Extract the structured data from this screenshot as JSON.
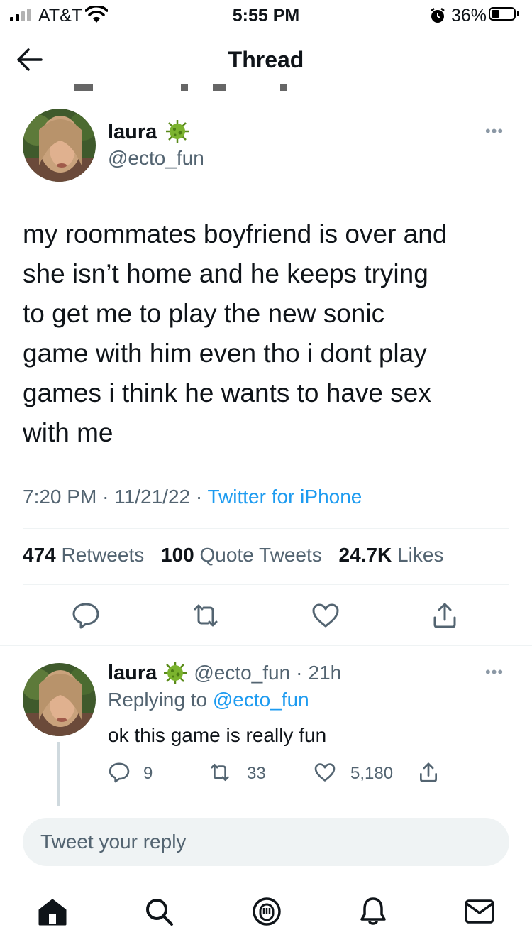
{
  "status_bar": {
    "carrier": "AT&T",
    "time": "5:55 PM",
    "battery_percent": "36%",
    "signal_icon": "signal-bars-icon",
    "wifi_icon": "wifi-icon",
    "alarm_icon": "alarm-clock-icon"
  },
  "header": {
    "title": "Thread",
    "back_icon": "arrow-left-icon"
  },
  "main_tweet": {
    "name": "laura",
    "badge_icon": "virus-emoji-icon",
    "handle": "@ecto_fun",
    "text": "my roommates boyfriend is over and\nshe isn’t home and he keeps trying\nto get me to play the new sonic\ngame with him even tho i dont play\ngames i think he wants to have sex\nwith me",
    "time": "7:20 PM",
    "date": "11/21/22",
    "source": "Twitter for iPhone",
    "retweets_count": "474",
    "retweets_label": "Retweets",
    "quotes_count": "100",
    "quotes_label": "Quote Tweets",
    "likes_count": "24.7K",
    "likes_label": "Likes"
  },
  "reply": {
    "name": "laura",
    "handle": "@ecto_fun",
    "age": "21h",
    "replying_prefix": "Replying to",
    "replying_handle": "@ecto_fun",
    "text": "ok this game is really fun",
    "reply_count": "9",
    "retweet_count": "33",
    "like_count": "5,180"
  },
  "compose": {
    "placeholder": "Tweet your reply"
  },
  "tab_bar": {
    "items": [
      "home-icon",
      "search-icon",
      "spaces-icon",
      "notifications-icon",
      "messages-icon"
    ]
  },
  "colors": {
    "accent": "#1d9bf0",
    "text": "#0f1419",
    "secondary": "#536471"
  }
}
